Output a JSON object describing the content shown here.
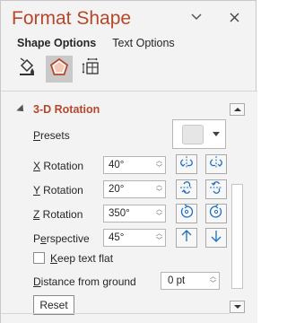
{
  "pane": {
    "title": "Format Shape",
    "pin_icon": "dropdown-chevron-icon",
    "close_icon": "close-icon"
  },
  "tabs": [
    {
      "label": "Shape Options",
      "active": true
    },
    {
      "label": "Text Options",
      "active": false
    }
  ],
  "icon_tabs": [
    {
      "name": "fill-line-icon",
      "active": false
    },
    {
      "name": "effects-pentagon-icon",
      "active": true
    },
    {
      "name": "size-properties-icon",
      "active": false
    }
  ],
  "section": {
    "title": "3-D Rotation"
  },
  "presets": {
    "label_prefix": "",
    "label_underlined": "P",
    "label_rest": "resets"
  },
  "rows": {
    "x": {
      "label_underlined": "X",
      "label_rest": " Rotation",
      "value": "40°"
    },
    "y": {
      "label_underlined": "Y",
      "label_rest": " Rotation",
      "value": "20°"
    },
    "z": {
      "label_underlined": "Z",
      "label_rest": " Rotation",
      "value": "350°"
    },
    "perspective": {
      "label_prefix": "P",
      "label_underlined": "e",
      "label_rest": "rspective",
      "value": "45°"
    }
  },
  "keep_text_flat": {
    "label_underlined": "K",
    "label_rest": "eep text flat",
    "checked": false
  },
  "distance": {
    "label_underlined": "D",
    "label_rest": "istance from ground",
    "value": "0 pt"
  },
  "reset_label": "Reset",
  "colors": {
    "accent": "#b7472a",
    "icon_blue": "#1e6fbf"
  }
}
